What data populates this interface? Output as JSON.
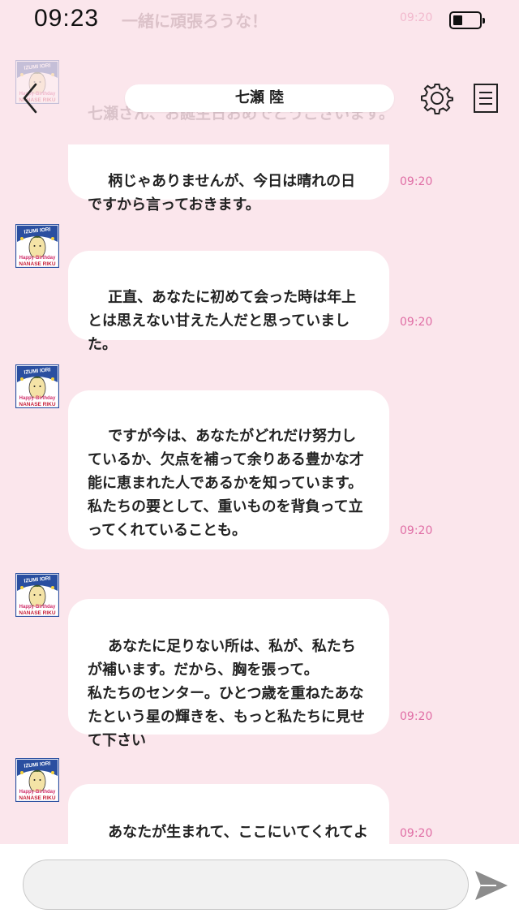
{
  "status_bar": {
    "time": "09:23",
    "battery_level": 0.35,
    "ghost_message": "一緒に頑張ろうな！",
    "ghost_time": "09:20"
  },
  "header": {
    "title": "七瀬 陸",
    "back_icon": "chevron-left-icon",
    "settings_icon": "gear-icon",
    "menu_icon": "document-menu-icon",
    "ghost_text": "七瀬さん、お誕生日おめでとうございます。"
  },
  "avatar": {
    "top_text": "IZUMI IORI",
    "bottom_text_1": "Happy-Birthday",
    "bottom_text_2": "NANASE RIKU"
  },
  "messages": [
    {
      "text": "柄じゃありませんが、今日は晴れの日ですから言っておきます。",
      "time": "09:20",
      "has_avatar": false
    },
    {
      "text": "正直、あなたに初めて会った時は年上とは思えない甘えた人だと思っていました。",
      "time": "09:20",
      "has_avatar": true
    },
    {
      "text": "ですが今は、あなたがどれだけ努力しているか、欠点を補って余りある豊かな才能に恵まれた人であるかを知っています。\n私たちの要として、重いものを背負って立ってくれていることも。",
      "time": "09:20",
      "has_avatar": true
    },
    {
      "text": "あなたに足りない所は、私が、私たちが補います。だから、胸を張って。\n私たちのセンター。ひとつ歳を重ねたあなたという星の輝きを、もっと私たちに見せて下さい",
      "time": "09:20",
      "has_avatar": true
    },
    {
      "text": "あなたが生まれて、ここにいてくれてよかった。",
      "time": "09:20",
      "has_avatar": true
    }
  ],
  "composer": {
    "input_value": "",
    "placeholder": "",
    "send_icon": "send-icon"
  },
  "colors": {
    "background": "#fbe6ec",
    "bubble": "#ffffff",
    "time": "#e06ea5",
    "avatar_border": "#2a4fa0"
  }
}
